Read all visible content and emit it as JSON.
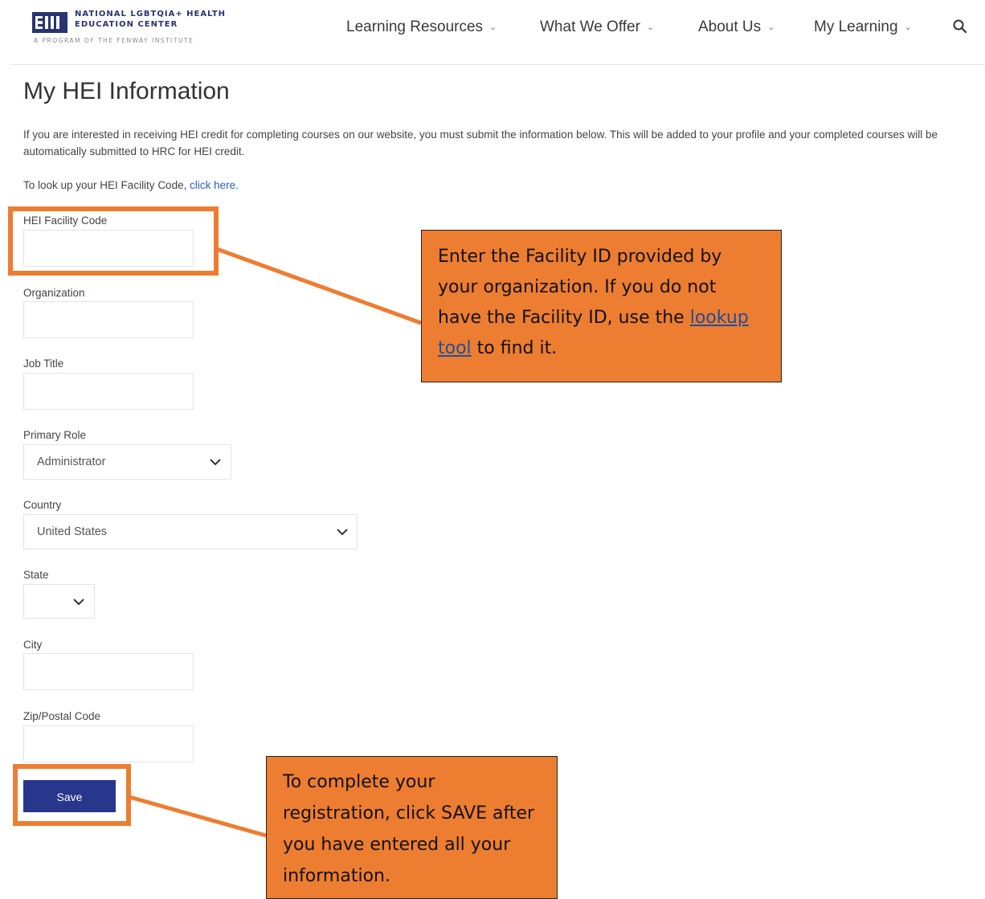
{
  "header": {
    "logo": {
      "line1": "NATIONAL LGBTQIA+ HEALTH",
      "line2": "EDUCATION CENTER",
      "line3": "A PROGRAM OF THE FENWAY INSTITUTE",
      "color": "#2a3470"
    },
    "nav": [
      {
        "label": "Learning Resources"
      },
      {
        "label": "What We Offer"
      },
      {
        "label": "About Us"
      },
      {
        "label": "My Learning"
      }
    ],
    "search_icon": "search-icon"
  },
  "page": {
    "title": "My HEI Information",
    "intro": "If you are interested in receiving HEI credit for completing courses on our website, you must submit the information below. This will be added to your profile and your completed courses will be automatically submitted to HRC for HEI credit.",
    "lookup_prefix": "To look up your HEI Facility Code, ",
    "lookup_link": "click here."
  },
  "form": {
    "facility_code": {
      "label": "HEI Facility Code",
      "value": ""
    },
    "organization": {
      "label": "Organization",
      "value": ""
    },
    "job_title": {
      "label": "Job Title",
      "value": ""
    },
    "primary_role": {
      "label": "Primary Role",
      "selected": "Administrator"
    },
    "country": {
      "label": "Country",
      "selected": "United States"
    },
    "state": {
      "label": "State",
      "selected": ""
    },
    "city": {
      "label": "City",
      "value": ""
    },
    "zip": {
      "label": "Zip/Postal Code",
      "value": ""
    },
    "save_label": "Save",
    "button_color": "#28368c"
  },
  "callouts": {
    "facility": {
      "text_before": "Enter the Facility ID provided by your organization. If you do not have the Facility ID, use the ",
      "link": "lookup tool",
      "text_after": " to find it."
    },
    "save": {
      "text": "To complete your registration, click SAVE after you have entered all your information."
    },
    "color": "#ed7d31"
  }
}
